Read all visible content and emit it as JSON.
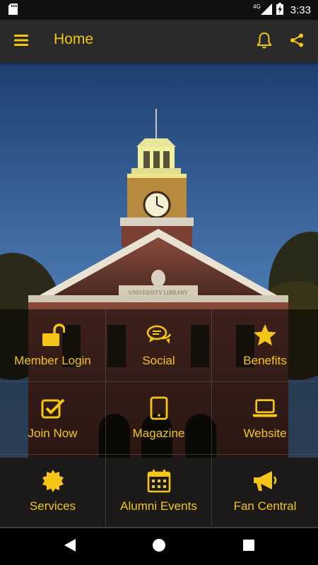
{
  "status_bar": {
    "time": "3:33",
    "network": "4G",
    "icons": [
      "sd-card-icon",
      "signal-icon",
      "battery-charging-icon"
    ]
  },
  "app_bar": {
    "title": "Home",
    "icons": {
      "menu": "hamburger-menu-icon",
      "notifications": "bell-icon",
      "share": "share-icon"
    }
  },
  "theme": {
    "accent": "#f5c518",
    "app_bar_bg": "#2a2a2a",
    "tile_bg": "rgba(0,0,0,0.55)"
  },
  "tiles": [
    {
      "label": "Member Login",
      "icon": "unlock-icon"
    },
    {
      "label": "Social",
      "icon": "chat-bubbles-icon"
    },
    {
      "label": "Benefits",
      "icon": "star-icon"
    },
    {
      "label": "Join Now",
      "icon": "checkbox-icon"
    },
    {
      "label": "Magazine",
      "icon": "tablet-icon"
    },
    {
      "label": "Website",
      "icon": "laptop-icon"
    },
    {
      "label": "Services",
      "icon": "sun-badge-icon"
    },
    {
      "label": "Alumni Events",
      "icon": "calendar-icon"
    },
    {
      "label": "Fan Central",
      "icon": "megaphone-icon"
    }
  ],
  "hero": {
    "building_inscription": "UNIVERSITY LIBRARY"
  },
  "nav_bar": {
    "icons": [
      "back-icon",
      "home-icon",
      "recents-icon"
    ]
  }
}
